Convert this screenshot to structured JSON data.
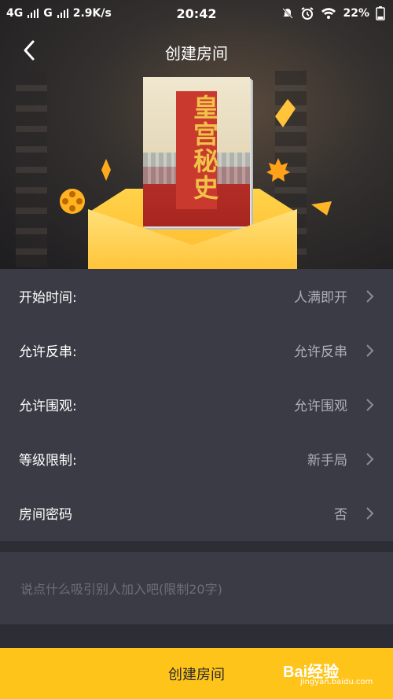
{
  "status_bar": {
    "net1": "4G",
    "net2": "G",
    "speed": "2.9K/s",
    "time": "20:42",
    "battery": "22%"
  },
  "header": {
    "title": "创建房间",
    "back_icon": "chevron-left-icon"
  },
  "poster": {
    "title_text": "皇宫秘史"
  },
  "settings": [
    {
      "label": "开始时间:",
      "value": "人满即开"
    },
    {
      "label": "允许反串:",
      "value": "允许反串"
    },
    {
      "label": "允许围观:",
      "value": "允许围观"
    },
    {
      "label": "等级限制:",
      "value": "新手局"
    },
    {
      "label": "房间密码",
      "value": "否"
    }
  ],
  "message": {
    "placeholder": "说点什么吸引别人加入吧(限制20字)",
    "value": ""
  },
  "footer": {
    "create_label": "创建房间"
  },
  "watermark": {
    "main": "Bai经验",
    "sub": "jingyan.baidu.com"
  },
  "colors": {
    "accent": "#ffc41a",
    "list_bg": "#3b3b45",
    "divider_bg": "#2d2d36",
    "muted_text": "#aeaeb6"
  }
}
